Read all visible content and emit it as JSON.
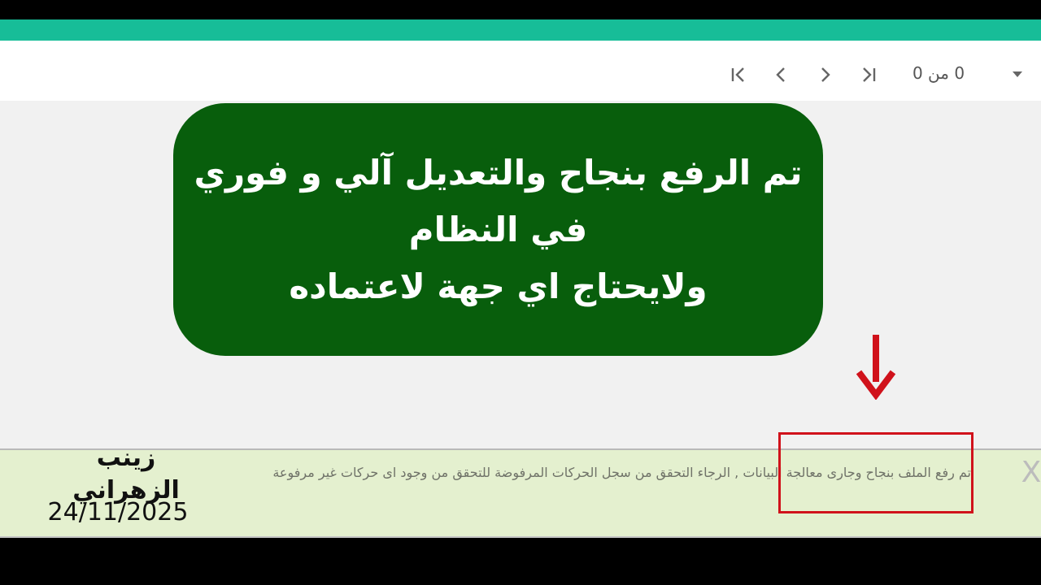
{
  "colors": {
    "accent": "#17bd98",
    "callout_bg": "#085e0c",
    "toast_bg": "#e4f0cf",
    "highlight": "#d0121b",
    "arrow": "#d0121b"
  },
  "pager": {
    "first_icon": "first-page-icon",
    "prev_icon": "chevron-left-icon",
    "next_icon": "chevron-right-icon",
    "last_icon": "last-page-icon",
    "range_text": "0 من 0",
    "dropdown_icon": "caret-down-icon"
  },
  "callout": {
    "line1": "تم الرفع بنجاح والتعديل آلي و فوري",
    "line2": "في النظام",
    "line3": "ولايحتاج اي جهة لاعتماده"
  },
  "annotation": {
    "arrow_icon": "down-arrow-icon"
  },
  "toast": {
    "message": "تم رفع الملف بنجاح وجارى معالجة البيانات , الرجاء التحقق من سجل الحركات المرفوضة للتحقق من وجود اى حركات غير مرفوعة",
    "close_label": "X"
  },
  "watermark": {
    "author": "زينب الزهراني",
    "date": "24/11/2025"
  }
}
